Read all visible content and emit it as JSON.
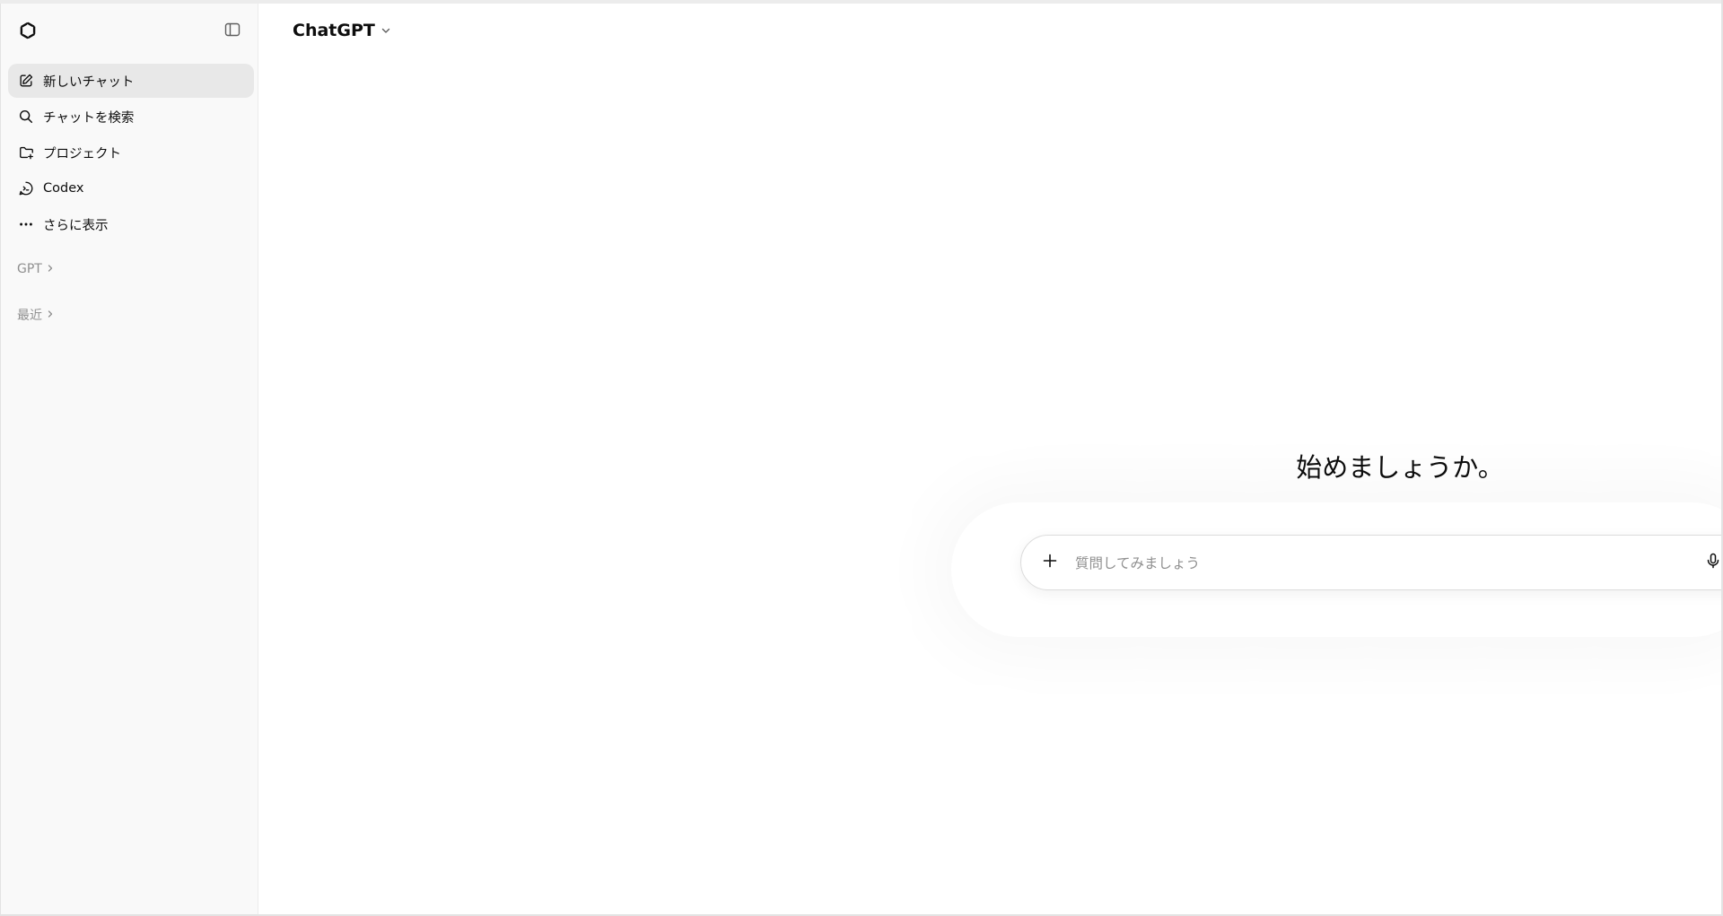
{
  "header": {
    "model_name": "ChatGPT"
  },
  "sidebar": {
    "items": [
      {
        "label": "新しいチャット",
        "icon": "compose-icon",
        "active": true
      },
      {
        "label": "チャットを検索",
        "icon": "search-icon",
        "active": false
      },
      {
        "label": "プロジェクト",
        "icon": "folder-plus-icon",
        "active": false
      },
      {
        "label": "Codex",
        "icon": "codex-icon",
        "active": false
      },
      {
        "label": "さらに表示",
        "icon": "more-dots-icon",
        "active": false
      }
    ],
    "sections": {
      "gpts_label": "GPT",
      "recents_label": "最近"
    }
  },
  "main": {
    "greeting": "始めましょうか。",
    "composer": {
      "placeholder": "質問してみましょう",
      "value": ""
    }
  },
  "colors": {
    "sidebar_bg": "#f9f9f9",
    "active_item_bg": "#e8e8e8",
    "text": "#0d0d0d",
    "muted_text": "#8f8f8f"
  }
}
